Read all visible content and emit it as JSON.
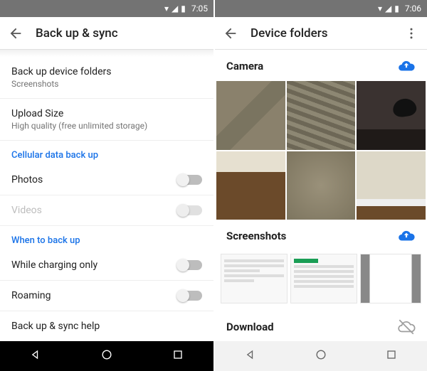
{
  "left": {
    "status_time": "7:05",
    "title": "Back up & sync",
    "rows": {
      "backup_folders": {
        "primary": "Back up device folders",
        "secondary": "Screenshots"
      },
      "upload_size": {
        "primary": "Upload Size",
        "secondary": "High quality (free unlimited storage)"
      }
    },
    "sections": {
      "cellular": "Cellular data back up",
      "when": "When to back up"
    },
    "toggles": {
      "photos": "Photos",
      "videos": "Videos",
      "charging": "While charging only",
      "roaming": "Roaming"
    },
    "help": "Back up & sync help"
  },
  "right": {
    "status_time": "7:06",
    "title": "Device folders",
    "folders": {
      "camera": "Camera",
      "screenshots": "Screenshots",
      "download": "Download"
    }
  }
}
